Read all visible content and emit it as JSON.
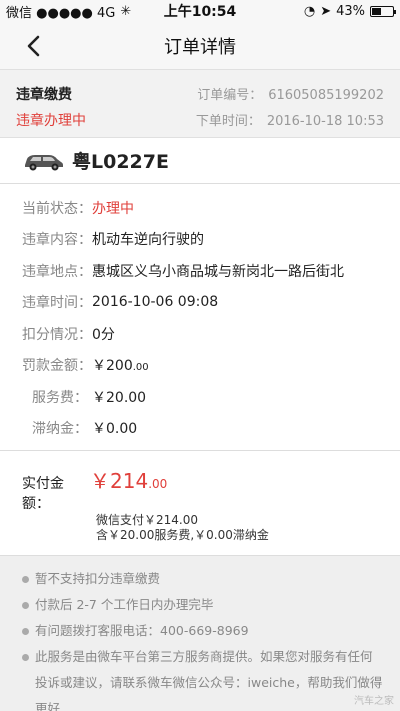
{
  "status_bar": {
    "left": "微信 ●●●●● 4G",
    "time": "上午10:54",
    "battery": "43%",
    "battery_level": 0.43
  },
  "nav": {
    "title": "订单详情"
  },
  "order": {
    "type": "违章缴费",
    "status": "违章办理中",
    "number_label": "订单编号：",
    "number": "61605085199202",
    "time_label": "下单时间：",
    "time": "2016-10-18 10:53"
  },
  "vehicle": {
    "plate": "粤L0227E"
  },
  "details": [
    {
      "label": "当前状态：",
      "value": "办理中"
    },
    {
      "label": "违章内容：",
      "value": "机动车逆向行驶的"
    },
    {
      "label": "违章地点：",
      "value": "惠城区义乌小商品城与新岗北一路后街北"
    },
    {
      "label": "违章时间：",
      "value": "2016-10-06 09:08"
    },
    {
      "label": "扣分情况：",
      "value": "0分"
    },
    {
      "label": "罚款金额：",
      "value_main": "￥200",
      "value_small": ".00"
    },
    {
      "label": "服务费：",
      "value": "￥20.00"
    },
    {
      "label": "滞纳金：",
      "value": "￥0.00"
    }
  ],
  "payment": {
    "label": "实付金额：",
    "amount_main": "￥214",
    "amount_small": ".00",
    "wechat": "微信支付￥214.00",
    "breakdown": "含￥20.00服务费,￥0.00滞纳金"
  },
  "notes": [
    "暂不支持扣分违章缴费",
    "付款后 2-7 个工作日内办理完毕",
    "有问题拨打客服电话：400-669-8969",
    "此服务是由微车平台第三方服务商提供。如果您对服务有任何投诉或建议，请联系微车微信公众号：iweiche，帮助我们做得更好"
  ],
  "watermark": "汽车之家",
  "colors": {
    "accent_red": "#e0403b"
  }
}
